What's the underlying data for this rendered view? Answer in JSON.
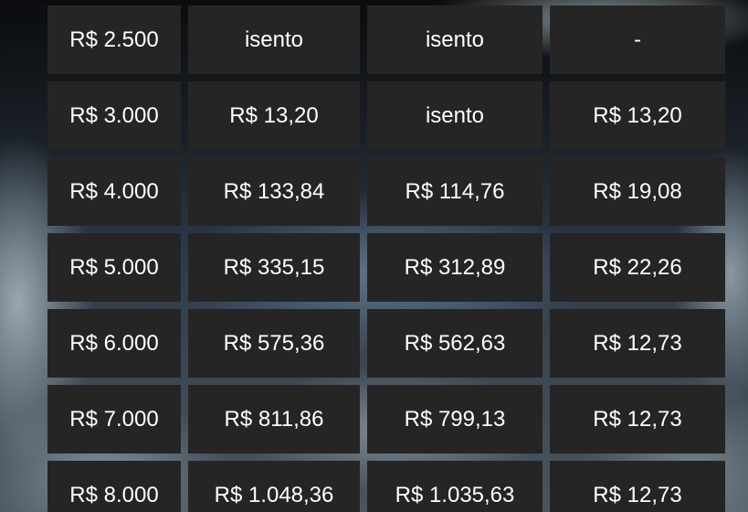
{
  "table": {
    "rows": [
      [
        "R$ 2.500",
        "isento",
        "isento",
        "-"
      ],
      [
        "R$ 3.000",
        "R$ 13,20",
        "isento",
        "R$ 13,20"
      ],
      [
        "R$ 4.000",
        "R$ 133,84",
        "R$ 114,76",
        "R$ 19,08"
      ],
      [
        "R$ 5.000",
        "R$ 335,15",
        "R$ 312,89",
        "R$ 22,26"
      ],
      [
        "R$ 6.000",
        "R$ 575,36",
        "R$ 562,63",
        "R$ 12,73"
      ],
      [
        "R$ 7.000",
        "R$ 811,86",
        "R$ 799,13",
        "R$ 12,73"
      ],
      [
        "R$ 8.000",
        "R$ 1.048,36",
        "R$ 1.035,63",
        "R$ 12,73"
      ]
    ]
  },
  "colors": {
    "cell_background": "#252525",
    "cell_text": "#ffffff"
  }
}
